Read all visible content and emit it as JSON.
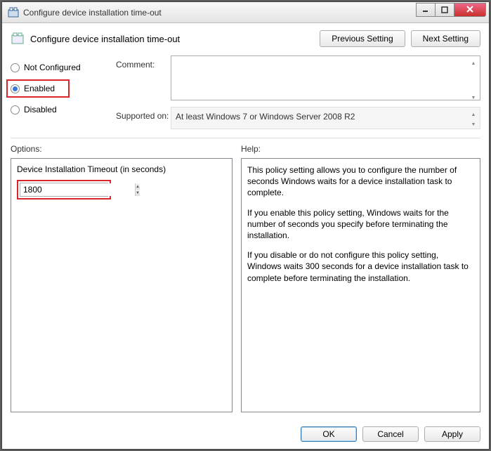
{
  "window": {
    "title": "Configure device installation time-out"
  },
  "header": {
    "title": "Configure device installation time-out",
    "previous_button": "Previous Setting",
    "next_button": "Next Setting"
  },
  "state": {
    "not_configured_label": "Not Configured",
    "enabled_label": "Enabled",
    "disabled_label": "Disabled",
    "selected": "Enabled"
  },
  "comment": {
    "label": "Comment:",
    "value": ""
  },
  "supported": {
    "label": "Supported on:",
    "value": "At least Windows 7 or Windows Server 2008 R2"
  },
  "options": {
    "header": "Options:",
    "timeout_label": "Device Installation Timeout (in seconds)",
    "timeout_value": "1800"
  },
  "help": {
    "header": "Help:",
    "p1": "This policy setting allows you to configure the number of seconds Windows waits for a device installation task to complete.",
    "p2": "If you enable this policy setting, Windows waits for the number of seconds you specify before terminating the installation.",
    "p3": "If you disable or do not configure this policy setting, Windows waits 300 seconds for a device installation task to complete before terminating the installation."
  },
  "footer": {
    "ok": "OK",
    "cancel": "Cancel",
    "apply": "Apply"
  },
  "highlight_color": "#d9252a"
}
